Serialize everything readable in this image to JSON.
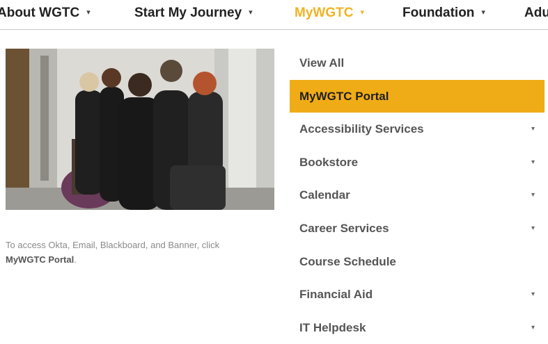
{
  "nav": {
    "items": [
      {
        "label": "About WGTC",
        "caret": "▾",
        "active": false
      },
      {
        "label": "Start My Journey",
        "caret": "▾",
        "active": false
      },
      {
        "label": "MyWGTC",
        "caret": "▾",
        "active": true
      },
      {
        "label": "Foundation",
        "caret": "▾",
        "active": false
      },
      {
        "label": "Adu",
        "caret": "",
        "active": false
      }
    ]
  },
  "caption": {
    "text": "To access Okta, Email, Blackboard, and Banner, click",
    "link": "MyWGTC Portal",
    "end": "."
  },
  "menu": {
    "items": [
      {
        "label": "View All",
        "submenu": false
      },
      {
        "label": "MyWGTC Portal",
        "submenu": false,
        "highlight": true
      },
      {
        "label": "Accessibility Services",
        "submenu": true
      },
      {
        "label": "Bookstore",
        "submenu": true
      },
      {
        "label": "Calendar",
        "submenu": true
      },
      {
        "label": "Career Services",
        "submenu": true
      },
      {
        "label": "Course Schedule",
        "submenu": false
      },
      {
        "label": "Financial Aid",
        "submenu": true
      },
      {
        "label": "IT Helpdesk",
        "submenu": true
      }
    ],
    "sub_caret": "▾"
  },
  "colors": {
    "accent": "#f0b323",
    "highlight_bg": "#f0ac17"
  }
}
